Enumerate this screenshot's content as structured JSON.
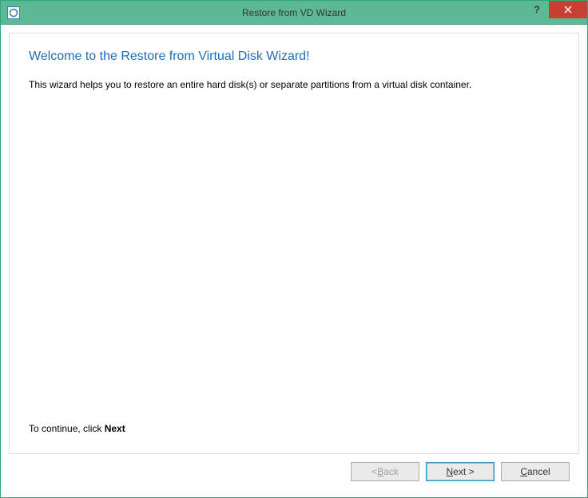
{
  "titlebar": {
    "title": "Restore from VD Wizard",
    "help_symbol": "?",
    "close_label": "Close"
  },
  "main": {
    "heading": "Welcome to the Restore from Virtual Disk Wizard!",
    "description": "This wizard helps you to restore an entire hard disk(s) or separate partitions from a virtual disk container.",
    "continue_prefix": "To continue, click ",
    "continue_bold": "Next"
  },
  "buttons": {
    "back_prefix": "< ",
    "back_u": "B",
    "back_rest": "ack",
    "next_u": "N",
    "next_rest": "ext >",
    "cancel_u": "C",
    "cancel_rest": "ancel"
  }
}
